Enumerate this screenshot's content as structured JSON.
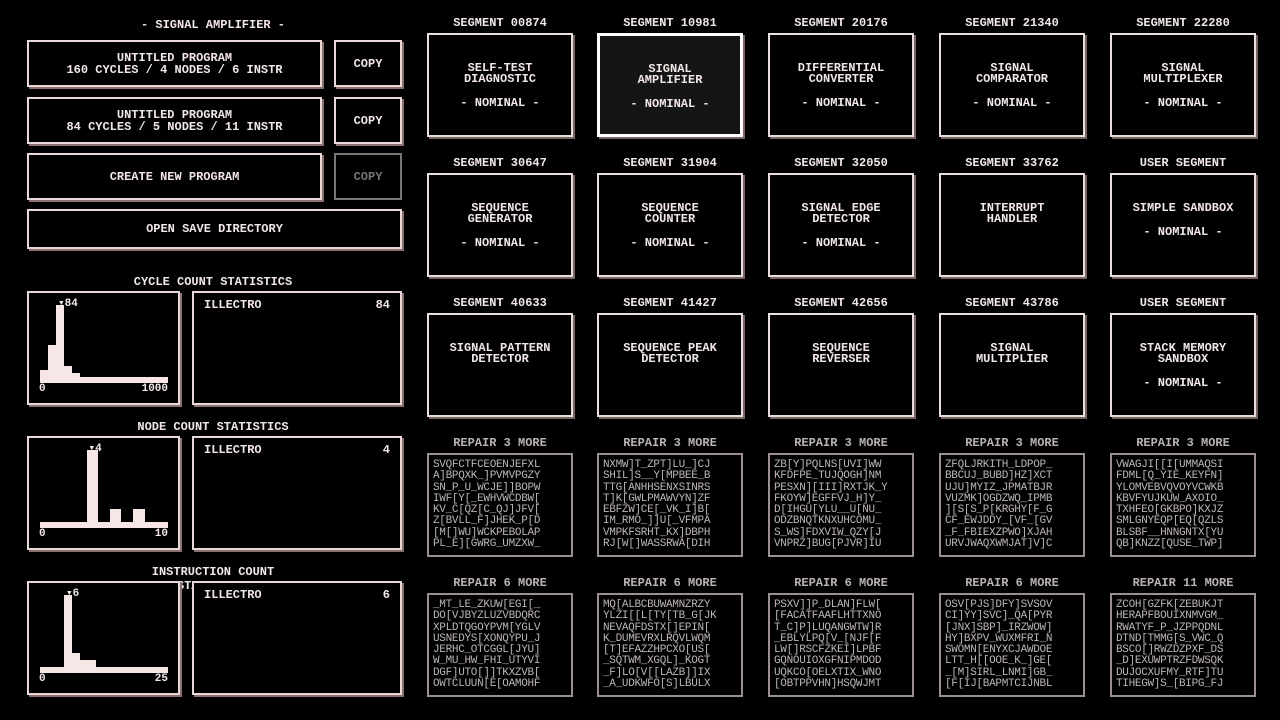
{
  "left": {
    "title": "- SIGNAL AMPLIFIER -",
    "programs": [
      {
        "name": "UNTITLED PROGRAM",
        "stats": "160 CYCLES / 4 NODES / 6 INSTR",
        "copy": "COPY"
      },
      {
        "name": "UNTITLED PROGRAM",
        "stats": "84 CYCLES / 5 NODES / 11 INSTR",
        "copy": "COPY"
      }
    ],
    "create": "CREATE NEW PROGRAM",
    "create_copy": "COPY",
    "open_dir": "OPEN SAVE DIRECTORY",
    "stats": [
      {
        "title": "CYCLE COUNT STATISTICS",
        "marker": "84",
        "min": "0",
        "max": "1000",
        "user": "ILLECTRO",
        "user_value": "84",
        "bins": [
          0.1,
          0.45,
          1.0,
          0.15,
          0.05,
          0,
          0,
          0,
          0,
          0,
          0,
          0,
          0,
          0,
          0,
          0
        ]
      },
      {
        "title": "NODE COUNT STATISTICS",
        "marker": "4",
        "min": "0",
        "max": "10",
        "user": "ILLECTRO",
        "user_value": "4",
        "bins": [
          0,
          0,
          0,
          0,
          1.0,
          0,
          0.18,
          0,
          0.18,
          0,
          0
        ]
      },
      {
        "title": "INSTRUCTION COUNT STATISTICS",
        "marker": "6",
        "min": "0",
        "max": "25",
        "user": "ILLECTRO",
        "user_value": "6",
        "bins": [
          0,
          0,
          0,
          1.0,
          0.2,
          0.1,
          0.1,
          0,
          0,
          0,
          0,
          0,
          0,
          0,
          0,
          0
        ]
      }
    ]
  },
  "segments": [
    {
      "id": "SEGMENT 00874",
      "name": [
        "SELF-TEST",
        "DIAGNOSTIC"
      ],
      "status": "- NOMINAL -"
    },
    {
      "id": "SEGMENT 10981",
      "name": [
        "SIGNAL",
        "AMPLIFIER"
      ],
      "status": "- NOMINAL -",
      "selected": true
    },
    {
      "id": "SEGMENT 20176",
      "name": [
        "DIFFERENTIAL",
        "CONVERTER"
      ],
      "status": "- NOMINAL -"
    },
    {
      "id": "SEGMENT 21340",
      "name": [
        "SIGNAL",
        "COMPARATOR"
      ],
      "status": "- NOMINAL -"
    },
    {
      "id": "SEGMENT 22280",
      "name": [
        "SIGNAL",
        "MULTIPLEXER"
      ],
      "status": "- NOMINAL -"
    },
    {
      "id": "SEGMENT 30647",
      "name": [
        "SEQUENCE",
        "GENERATOR"
      ],
      "status": "- NOMINAL -"
    },
    {
      "id": "SEGMENT 31904",
      "name": [
        "SEQUENCE",
        "COUNTER"
      ],
      "status": "- NOMINAL -"
    },
    {
      "id": "SEGMENT 32050",
      "name": [
        "SIGNAL EDGE",
        "DETECTOR"
      ],
      "status": "- NOMINAL -"
    },
    {
      "id": "SEGMENT 33762",
      "name": [
        "INTERRUPT",
        "HANDLER"
      ],
      "status": ""
    },
    {
      "id": "USER SEGMENT",
      "name": [
        "SIMPLE SANDBOX"
      ],
      "status": "- NOMINAL -"
    },
    {
      "id": "SEGMENT 40633",
      "name": [
        "SIGNAL PATTERN",
        "DETECTOR"
      ],
      "status": ""
    },
    {
      "id": "SEGMENT 41427",
      "name": [
        "SEQUENCE PEAK",
        "DETECTOR"
      ],
      "status": ""
    },
    {
      "id": "SEGMENT 42656",
      "name": [
        "SEQUENCE",
        "REVERSER"
      ],
      "status": ""
    },
    {
      "id": "SEGMENT 43786",
      "name": [
        "SIGNAL",
        "MULTIPLIER"
      ],
      "status": ""
    },
    {
      "id": "USER SEGMENT",
      "name": [
        "STACK MEMORY",
        "SANDBOX"
      ],
      "status": "- NOMINAL -"
    }
  ],
  "corrupted": [
    {
      "label": "REPAIR 3 MORE",
      "text": "SVQFCTFCEOENJEFXL\nA]BPQXK_]PVMVPGZY\nSN_P_U_WCJE]]BOPW\nIWF[Y[_EWHVWCDBW[\nKV_C[QZ[C_QJ]JFV[\nZ[BVLL_F]JHEK_P[D\n[M[]WU]WCKPEBOLAP\nPL_E][GWRG_UMZXW_"
    },
    {
      "label": "REPAIR 3 MORE",
      "text": "NXMW]T_ZPT]LU_]CJ\nSHIL]S__Y[MPBEE_B\nTTG[ANHHSENXSINRS\nT]K[GWLPMAWVYN]ZF\nEBFZW]CE[_VK_I]B[\nIM_RMO_]]U[_VFMPA\nVMPKFSRHT_KX]DBPH\nRJ[W[]WASSRWA[DIH"
    },
    {
      "label": "REPAIR 3 MORE",
      "text": "ZB[Y]PQLNS[UVI]WW\nKFDFPE_TUJQOGH]NM\nPESXN][III]RXTJK_Y\nFKOYW]EGFFVJ_H]Y_\nD[IHGU[YLU__U[NU_\nODZBNQTKNXUHCOMU_\nS_WS]FDXVIW_QZY[J\nVNPRZ]BUG[PJVR]IU"
    },
    {
      "label": "REPAIR 3 MORE",
      "text": "ZFQLJRKITH_LDPOP_\nBBCUJ_BUBD]HZ]XCT\nUJU]MYIZ_JPMATBJR\nVUZMK]OGDZWQ_IPMB\n][S[S_P[KRGHY[F_G\nCF_EWJDDY_[VF_[GV\n_F_FBIEXZPWO]XJAH\nURVJWAQXWMJAT]V]C"
    },
    {
      "label": "REPAIR 3 MORE",
      "text": "VWAGJI[[I[UMMAQSI\nFDML[Q_YIE_KEYFN]\nYLOMVEBVQVOYVCWKB\nKBVFYUJKUW_AXOIO_\nTXHFEO[GKBPO]KXJZ\nSMLGNYEQP[EQ[QZLS\nBLSBF__HNNGNTX[YU\nQB]KNZZ[QUSE_TWP]"
    },
    {
      "label": "REPAIR 6 MORE",
      "text": "_MT_LE_ZKUW[EGI[_\nDO[VJBYZLUZVBDQRC\nXPLDTQGOYPVM[YGLV\nUSNEDYS[XONQYPU_J\nJERHC_OTCGGL[JYU]\nW_MU_HW_FHI_UTYVI\nDGF]UTO[]]TKXZVB[\nOWTCLUUN[E[OAMOHF"
    },
    {
      "label": "REPAIR 6 MORE",
      "text": "MQ[ALBCBUWAMNZRZY\nYLZI[[L[TY[TB_G[JK\nNEVAQFDSTX[]EPIN[\nK_DUMEVRXLRQVLWQM\n[T]EFAZZHPCXO[US[\n_SQTWM_XGQL]_KOGT\n_F]LO[V[[LAZB]]IX\n_A_UDKWFO[S]LBULX"
    },
    {
      "label": "REPAIR 6 MORE",
      "text": "PSXV]]P_DLAN]FLW[\n[FACATFAAFLHTTXNO\nT_C]P]LUQANGWTW]R\n_EBLYLPQ[V_[NJF[F\nLW[]RSCFZKEI]LPBF\nGQNOUIOXGFNIPMDOD\nUQKCO[OELXTIX_WNO\n[OBTPPVHN]HSQWJMT"
    },
    {
      "label": "REPAIR 6 MORE",
      "text": "OSV[PJS]DFY]SVSOV\nCI]YY]SVC]_QA[PYR\n[JNX]SBP]_IRZWOW]\nHY]BXPV_WUXMFRI_N\nSWOMN[ENYXCJAWDOE\nLTT_H[[OOE_K_]GE[\n_[M]SIRL_LNMI]GB_\n[F[IJ[BAPMTCIJNBL"
    },
    {
      "label": "REPAIR 11 MORE",
      "text": "ZCOH[GZFK[ZEBUKJT\nHERAPFBOUIXNMVGM_\nRWATYF_P_JZPPQDNL\nDTND[TMMG[S_VWC_Q\nBSCO[]RWZDZPXF_DS\n_D]EXUWPTRZFDWSQK\nDUJOCXUFMY_RTF]TU\nTIHEGW]S_[BIPG_FJ"
    }
  ],
  "colors": {
    "bg": "#000000",
    "fg": "#f2e6e6",
    "dim": "#bdb5b5"
  }
}
